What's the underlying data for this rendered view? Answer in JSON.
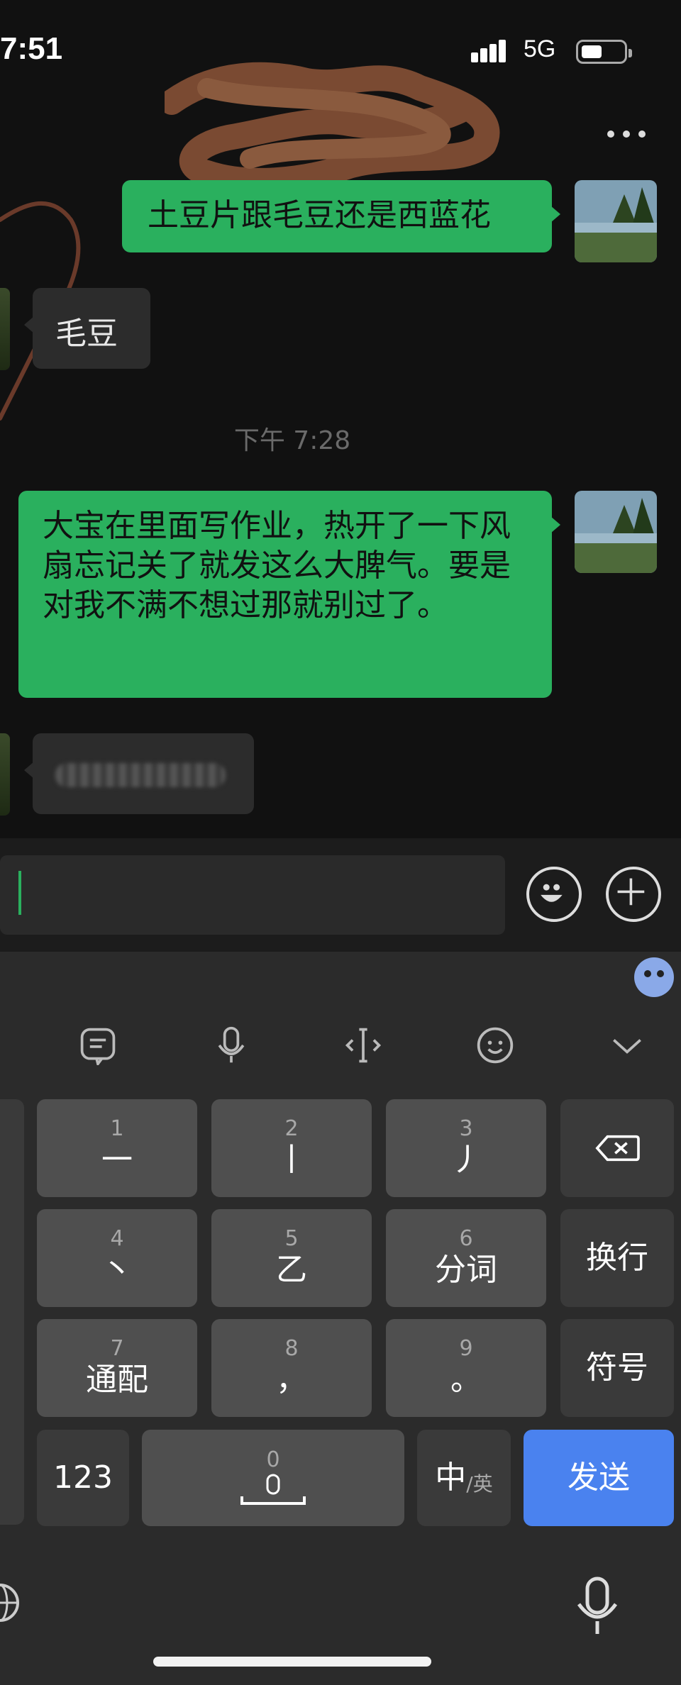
{
  "status_bar": {
    "time": "7:51",
    "network": "5G"
  },
  "chat": {
    "messages": [
      {
        "direction": "out",
        "text": "土豆片跟毛豆还是西蓝花"
      },
      {
        "direction": "in",
        "text": "毛豆"
      },
      {
        "direction": "out",
        "text": "大宝在里面写作业，热开了一下风扇忘记关了就发这么大脾气。要是对我不满不想过那就别过了。"
      }
    ],
    "timestamp": "下午 7:28"
  },
  "input": {
    "value": ""
  },
  "keyboard": {
    "keys": [
      {
        "num": "1",
        "label": "一"
      },
      {
        "num": "2",
        "label": "丨"
      },
      {
        "num": "3",
        "label": "丿"
      },
      {
        "num": "4",
        "label": "丶"
      },
      {
        "num": "5",
        "label": "乙"
      },
      {
        "num": "6",
        "label": "分词"
      },
      {
        "num": "7",
        "label": "通配"
      },
      {
        "num": "8",
        "label": "，"
      },
      {
        "num": "9",
        "label": "。"
      }
    ],
    "newline": "换行",
    "symbols": "符号",
    "numbers": "123",
    "space_num": "0",
    "lang_main": "中",
    "lang_alt": "/英",
    "send": "发送"
  },
  "colors": {
    "accent_green": "#2ab05e",
    "send_blue": "#4a82ef"
  }
}
